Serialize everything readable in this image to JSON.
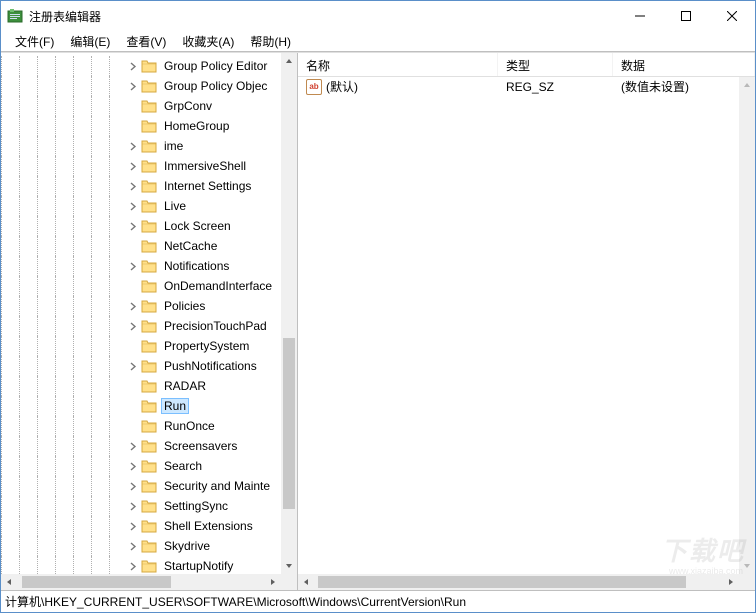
{
  "window": {
    "title": "注册表编辑器"
  },
  "menu": {
    "file": "文件(F)",
    "edit": "编辑(E)",
    "view": "查看(V)",
    "favorites": "收藏夹(A)",
    "help": "帮助(H)"
  },
  "tree": {
    "items": [
      {
        "label": "Group Policy Editor",
        "expandable": true,
        "selected": false
      },
      {
        "label": "Group Policy Objec",
        "expandable": true,
        "selected": false
      },
      {
        "label": "GrpConv",
        "expandable": false,
        "selected": false
      },
      {
        "label": "HomeGroup",
        "expandable": false,
        "selected": false
      },
      {
        "label": "ime",
        "expandable": true,
        "selected": false
      },
      {
        "label": "ImmersiveShell",
        "expandable": true,
        "selected": false
      },
      {
        "label": "Internet Settings",
        "expandable": true,
        "selected": false
      },
      {
        "label": "Live",
        "expandable": true,
        "selected": false
      },
      {
        "label": "Lock Screen",
        "expandable": true,
        "selected": false
      },
      {
        "label": "NetCache",
        "expandable": false,
        "selected": false
      },
      {
        "label": "Notifications",
        "expandable": true,
        "selected": false
      },
      {
        "label": "OnDemandInterface",
        "expandable": false,
        "selected": false
      },
      {
        "label": "Policies",
        "expandable": true,
        "selected": false
      },
      {
        "label": "PrecisionTouchPad",
        "expandable": true,
        "selected": false
      },
      {
        "label": "PropertySystem",
        "expandable": false,
        "selected": false
      },
      {
        "label": "PushNotifications",
        "expandable": true,
        "selected": false
      },
      {
        "label": "RADAR",
        "expandable": false,
        "selected": false
      },
      {
        "label": "Run",
        "expandable": false,
        "selected": true
      },
      {
        "label": "RunOnce",
        "expandable": false,
        "selected": false
      },
      {
        "label": "Screensavers",
        "expandable": true,
        "selected": false
      },
      {
        "label": "Search",
        "expandable": true,
        "selected": false
      },
      {
        "label": "Security and Mainte",
        "expandable": true,
        "selected": false
      },
      {
        "label": "SettingSync",
        "expandable": true,
        "selected": false
      },
      {
        "label": "Shell Extensions",
        "expandable": true,
        "selected": false
      },
      {
        "label": "Skydrive",
        "expandable": true,
        "selected": false
      },
      {
        "label": "StartupNotify",
        "expandable": true,
        "selected": false
      }
    ]
  },
  "list": {
    "columns": {
      "name": "名称",
      "type": "类型",
      "data": "数据"
    },
    "rows": [
      {
        "name": "(默认)",
        "type": "REG_SZ",
        "data": "(数值未设置)",
        "value_kind": "string"
      }
    ]
  },
  "statusbar": {
    "path": "计算机\\HKEY_CURRENT_USER\\SOFTWARE\\Microsoft\\Windows\\CurrentVersion\\Run"
  },
  "watermark": {
    "main": "下载吧",
    "sub": "www.xiazaiba.com"
  }
}
